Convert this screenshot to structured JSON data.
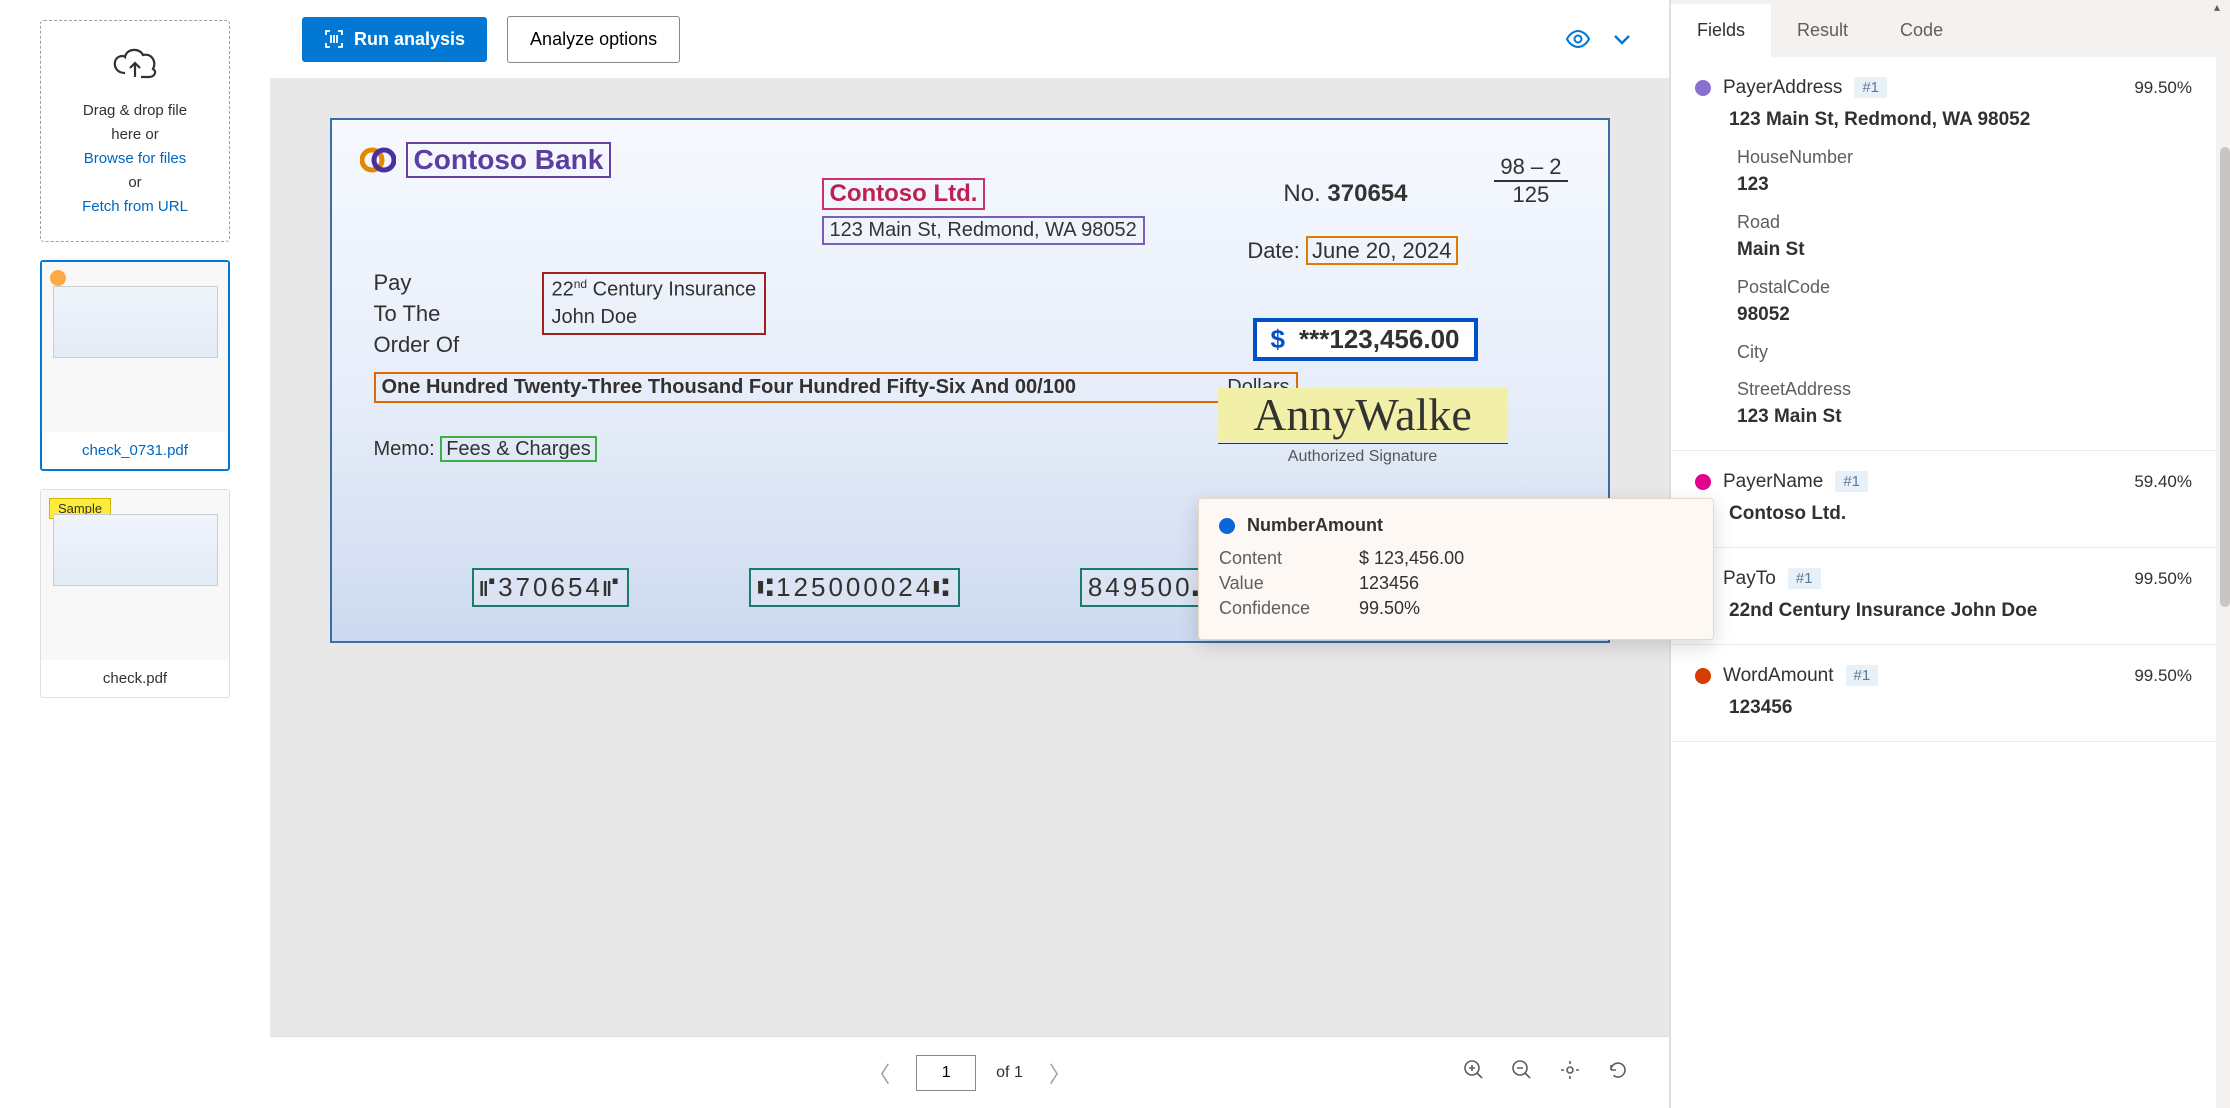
{
  "dropzone": {
    "line1": "Drag & drop file",
    "line2": "here or",
    "browse": "Browse for files",
    "or": "or",
    "fetch": "Fetch from URL"
  },
  "thumbs": [
    {
      "name": "check_0731.pdf",
      "selected": true,
      "sample": false
    },
    {
      "name": "check.pdf",
      "selected": false,
      "sample": true,
      "sample_label": "Sample"
    }
  ],
  "toolbar": {
    "run": "Run analysis",
    "options": "Analyze options"
  },
  "check": {
    "bank": "Contoso Bank",
    "payer_name": "Contoso Ltd.",
    "payer_addr": "123 Main St, Redmond, WA 98052",
    "number_label": "No.",
    "number": "370654",
    "routing_top": "98 – 2",
    "routing_bot": "125",
    "date_label": "Date:",
    "date": "June 20, 2024",
    "pay_label_1": "Pay",
    "pay_label_2": "To The",
    "pay_label_3": "Order Of",
    "payto_line1_a": "22",
    "payto_line1_sup": "nd",
    "payto_line1_b": " Century Insurance",
    "payto_line2": "John Doe",
    "amount_symbol": "$",
    "amount": "***123,456.00",
    "word_amount": "One Hundred Twenty-Three Thousand Four Hundred Fifty-Six And 00/100",
    "dollars": "Dollars",
    "memo_label": "Memo:",
    "memo": "Fees & Charges",
    "signature": "AnnyWalke",
    "sig_label": "Authorized Signature",
    "micr1": "⑈370654⑈",
    "micr2": "⑆125000024⑆",
    "micr3": "849500⑉55432⑈"
  },
  "tooltip": {
    "color": "#0a66d8",
    "title": "NumberAmount",
    "rows": [
      {
        "k": "Content",
        "v": "$ 123,456.00"
      },
      {
        "k": "Value",
        "v": "123456"
      },
      {
        "k": "Confidence",
        "v": "99.50%"
      }
    ]
  },
  "pager": {
    "page": "1",
    "of": "of 1"
  },
  "tabs": {
    "fields": "Fields",
    "result": "Result",
    "code": "Code"
  },
  "fields": [
    {
      "color": "#8a6fd1",
      "name": "PayerAddress",
      "badge": "#1",
      "conf": "99.50%",
      "value": "123 Main St, Redmond, WA 98052",
      "sub": [
        {
          "k": "HouseNumber",
          "v": "123"
        },
        {
          "k": "Road",
          "v": "Main St"
        },
        {
          "k": "PostalCode",
          "v": "98052"
        },
        {
          "k": "City",
          "v": ""
        },
        {
          "k": "StreetAddress",
          "v": "123 Main St"
        }
      ]
    },
    {
      "color": "#e3008c",
      "name": "PayerName",
      "badge": "#1",
      "conf": "59.40%",
      "value": "Contoso Ltd."
    },
    {
      "color": "#a4262c",
      "name": "PayTo",
      "badge": "#1",
      "conf": "99.50%",
      "value": "22nd Century Insurance John Doe"
    },
    {
      "color": "#d83b01",
      "name": "WordAmount",
      "badge": "#1",
      "conf": "99.50%",
      "value": "123456"
    }
  ]
}
